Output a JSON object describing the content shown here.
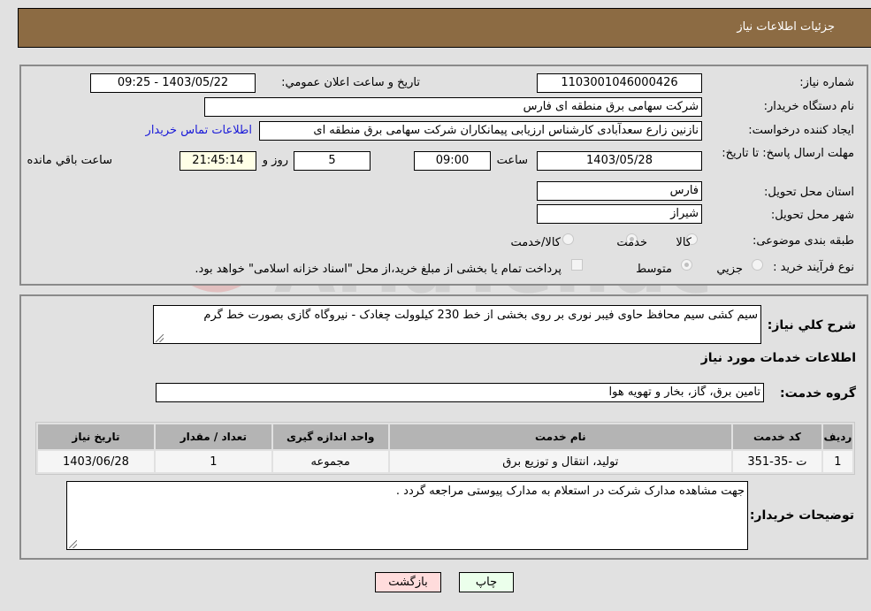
{
  "header": {
    "title": "جزئیات اطلاعات نیاز"
  },
  "details": {
    "need_number_label": "شماره نیاز:",
    "need_number": "1103001046000426",
    "announce_label": "تاریخ و ساعت اعلان عمومي:",
    "announce_value": "1403/05/22 - 09:25",
    "buyer_org_label": "نام دستگاه خریدار:",
    "buyer_org": "شرکت سهامی برق منطقه ای فارس",
    "creator_label": "ایجاد کننده درخواست:",
    "creator": "نازنین زارع سعدآبادی کارشناس ارزیابی پیمانکاران شرکت سهامی برق منطقه ای",
    "contact_link": "اطلاعات تماس خریدار",
    "deadline_label": "مهلت ارسال پاسخ: تا تاریخ:",
    "deadline_date": "1403/05/28",
    "time_label": "ساعت",
    "deadline_time": "09:00",
    "days_value": "5",
    "days_label": "روز و",
    "remaining_time": "21:45:14",
    "remaining_label": "ساعت باقي مانده",
    "province_label": "استان محل تحویل:",
    "province": "فارس",
    "city_label": "شهر محل تحویل:",
    "city": "شیراز",
    "category_label": "طبقه بندی موضوعی:",
    "category_options": [
      {
        "label": "کالا",
        "checked": false
      },
      {
        "label": "خدمت",
        "checked": true
      },
      {
        "label": "کالا/خدمت",
        "checked": false
      }
    ],
    "process_label": "نوع فرآیند خرید :",
    "process_options": [
      {
        "label": "جزيي",
        "checked": false
      },
      {
        "label": "متوسط",
        "checked": true
      }
    ],
    "treasury_note": "پرداخت تمام یا بخشی از مبلغ خرید،از محل \"اسناد خزانه اسلامی\" خواهد بود.",
    "treasury_checked": false
  },
  "summary": {
    "description_label": "شرح کلي نیاز:",
    "description": "سیم کشی سیم محافظ حاوی فیبر نوری بر روی بخشی از خط 230 کیلوولت چغادک - نیروگاه گازی بصورت خط گرم",
    "services_heading": "اطلاعات خدمات مورد نیاز",
    "service_group_label": "گروه خدمت:",
    "service_group": "تامین برق، گاز، بخار و تهویه هوا"
  },
  "table": {
    "headers": [
      "ردیف",
      "کد خدمت",
      "نام خدمت",
      "واحد اندازه گیری",
      "تعداد / مقدار",
      "تاریخ نیاز"
    ],
    "rows": [
      [
        "1",
        "ت -35-351",
        "تولید، انتقال و توزیع برق",
        "مجموعه",
        "1",
        "1403/06/28"
      ]
    ]
  },
  "buyer_notes": {
    "label": "توضیحات خریدار:",
    "text": "جهت مشاهده مدارک شرکت در استعلام به مدارک پیوستی مراجعه گردد ."
  },
  "buttons": {
    "print": "چاپ",
    "back": "بازگشت"
  },
  "watermark": {
    "text": "AriaTender.neT"
  }
}
